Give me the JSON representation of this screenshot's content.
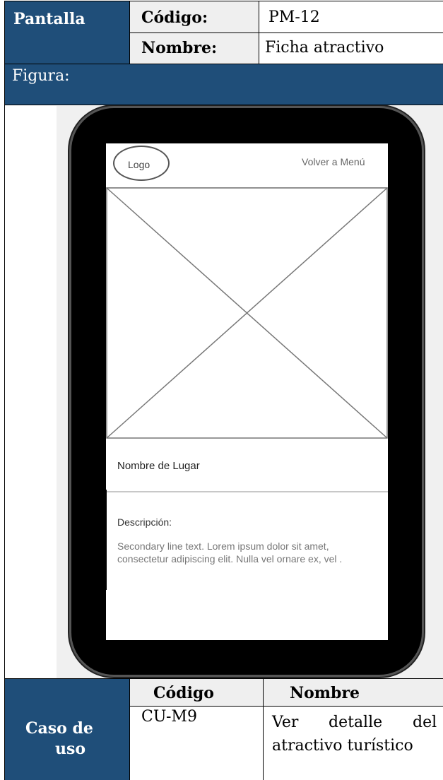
{
  "header": {
    "pantalla_label": "Pantalla",
    "codigo_label": "Código:",
    "codigo_value": "PM-12",
    "nombre_label": "Nombre:",
    "nombre_value": "Ficha atractivo"
  },
  "figura_label": "Figura:",
  "mockup": {
    "logo": "Logo",
    "back_link": "Volver a Menú",
    "place_name": "Nombre de Lugar",
    "description_label": "Descripción:",
    "description_line1": "Secondary line text. Lorem ipsum dolor sit amet,",
    "description_line2": "consectetur adipiscing elit. Nulla vel ornare ex, vel ."
  },
  "use_case": {
    "label_line1": "Caso de",
    "label_line2": "uso",
    "col_codigo": "Código",
    "col_nombre": "Nombre",
    "codigo_value": "CU-M9",
    "nombre_line1_words": [
      "Ver",
      "detalle",
      "del"
    ],
    "nombre_line2": "atractivo turístico"
  }
}
